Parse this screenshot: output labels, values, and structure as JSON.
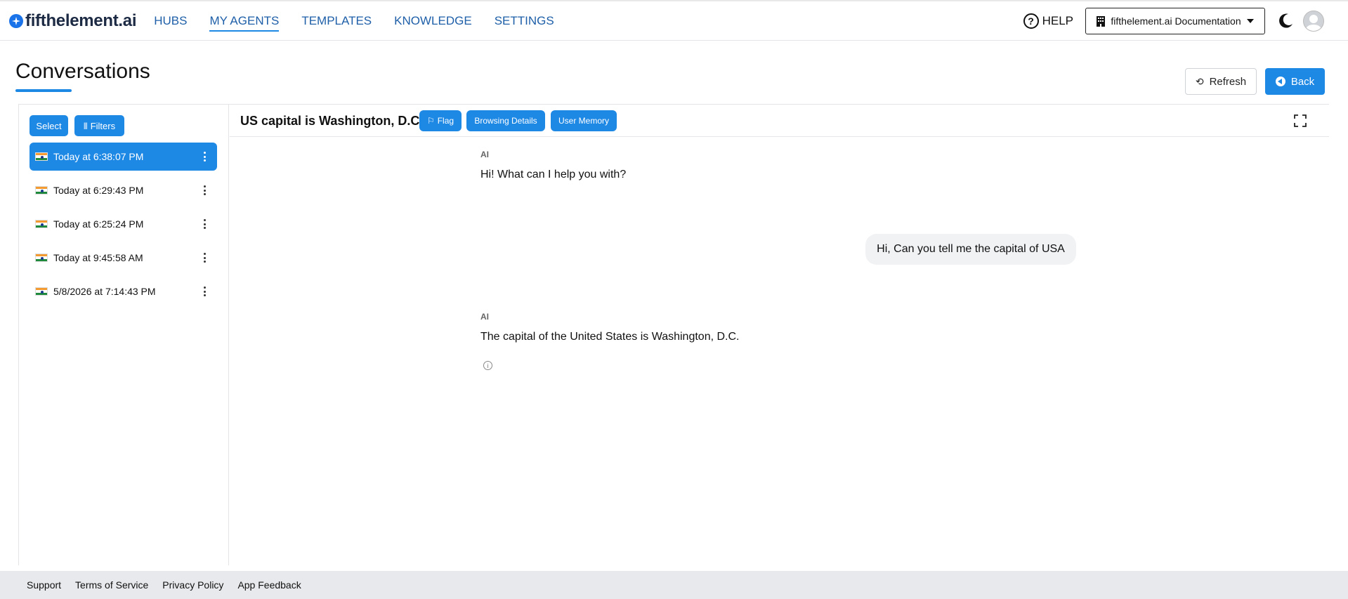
{
  "app": {
    "logo_text": "fifthelement.ai",
    "nav": [
      {
        "label": "HUBS"
      },
      {
        "label": "MY AGENTS"
      },
      {
        "label": "TEMPLATES"
      },
      {
        "label": "KNOWLEDGE"
      },
      {
        "label": "SETTINGS"
      }
    ],
    "active_nav": "MY AGENTS",
    "help_label": "HELP",
    "org_selector": "fifthelement.ai Documentation"
  },
  "page": {
    "title": "Conversations",
    "refresh_label": "Refresh",
    "back_label": "Back"
  },
  "sidebar": {
    "select_label": "Select",
    "filters_label": "Filters",
    "conversations": [
      {
        "label": "Today at 6:38:07 PM",
        "active": true
      },
      {
        "label": "Today at 6:29:43 PM",
        "active": false
      },
      {
        "label": "Today at 6:25:24 PM",
        "active": false
      },
      {
        "label": "Today at 9:45:58 AM",
        "active": false
      },
      {
        "label": "5/8/2026 at 7:14:43 PM",
        "active": false
      }
    ]
  },
  "chat": {
    "title": "US capital is Washington, D.C.",
    "flag_label": "Flag",
    "browsing_label": "Browsing Details",
    "memory_label": "User Memory",
    "messages": [
      {
        "role": "AI",
        "text": "Hi! What can I help you with?"
      },
      {
        "role": "user",
        "text": "Hi, Can you tell me the capital of USA"
      },
      {
        "role": "AI",
        "text": "The capital of the United States is Washington, D.C."
      }
    ]
  },
  "footer": {
    "links": [
      "Support",
      "Terms of Service",
      "Privacy Policy",
      "App Feedback"
    ]
  },
  "colors": {
    "accent": "#1e88e5",
    "nav_link": "#1e5fa8",
    "footer_bg": "#e8e9ec"
  }
}
